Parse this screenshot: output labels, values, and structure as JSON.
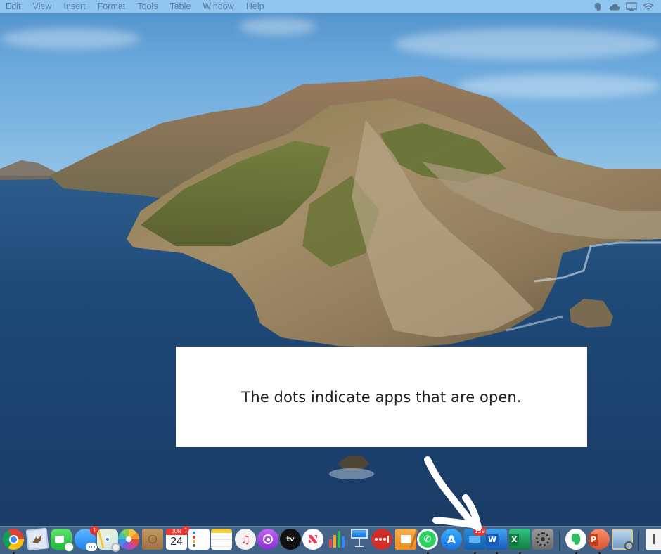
{
  "menubar": {
    "items": [
      "Edit",
      "View",
      "Insert",
      "Format",
      "Tools",
      "Table",
      "Window",
      "Help"
    ],
    "status_icons": [
      "evernote-icon",
      "creative-cloud-icon",
      "airplay-icon",
      "wifi-icon"
    ]
  },
  "caption": {
    "text": "The dots indicate apps that are open."
  },
  "dock": {
    "apps": [
      {
        "name": "Google Chrome",
        "icon": "chrome-icon",
        "running": true
      },
      {
        "name": "Mail",
        "icon": "mail-icon",
        "running": false
      },
      {
        "name": "FaceTime",
        "icon": "facetime-icon",
        "running": false
      },
      {
        "name": "Messages",
        "icon": "messages-icon",
        "running": false,
        "badge": "1"
      },
      {
        "name": "Maps",
        "icon": "maps-icon",
        "running": false
      },
      {
        "name": "Photos",
        "icon": "photos-icon",
        "running": false
      },
      {
        "name": "Contacts",
        "icon": "contacts-icon",
        "running": false
      },
      {
        "name": "Calendar",
        "icon": "calendar-icon",
        "running": false,
        "badge": "1",
        "month": "JUN",
        "day": "24"
      },
      {
        "name": "Reminders",
        "icon": "reminders-icon",
        "running": false
      },
      {
        "name": "Notes",
        "icon": "notes-icon",
        "running": false
      },
      {
        "name": "Music",
        "icon": "music-icon",
        "running": false
      },
      {
        "name": "Podcasts",
        "icon": "podcasts-icon",
        "running": false
      },
      {
        "name": "TV",
        "icon": "apple-tv-icon",
        "running": false,
        "label": "tv"
      },
      {
        "name": "News",
        "icon": "news-icon",
        "running": false
      },
      {
        "name": "Numbers",
        "icon": "numbers-icon",
        "running": false
      },
      {
        "name": "Keynote",
        "icon": "keynote-icon",
        "running": false
      },
      {
        "name": "LastPass",
        "icon": "lastpass-icon",
        "running": false
      },
      {
        "name": "Pages",
        "icon": "pages-icon",
        "running": false
      },
      {
        "name": "WhatsApp",
        "icon": "whatsapp-icon",
        "running": true
      },
      {
        "name": "App Store",
        "icon": "app-store-icon",
        "running": false
      },
      {
        "name": "Microsoft Outlook",
        "icon": "outlook-icon",
        "running": true,
        "badge": "129"
      },
      {
        "name": "Microsoft Word",
        "icon": "word-icon",
        "running": true,
        "label": "W"
      },
      {
        "name": "Microsoft Excel",
        "icon": "excel-icon",
        "running": true,
        "label": "X"
      },
      {
        "name": "System Preferences",
        "icon": "system-preferences-icon",
        "running": false
      },
      {
        "name": "Evernote",
        "icon": "evernote-icon",
        "running": true
      },
      {
        "name": "Microsoft PowerPoint",
        "icon": "powerpoint-icon",
        "running": true,
        "label": "P"
      },
      {
        "name": "Preview",
        "icon": "preview-icon",
        "running": false
      },
      {
        "name": "Document",
        "icon": "document-icon",
        "running": false
      }
    ]
  }
}
